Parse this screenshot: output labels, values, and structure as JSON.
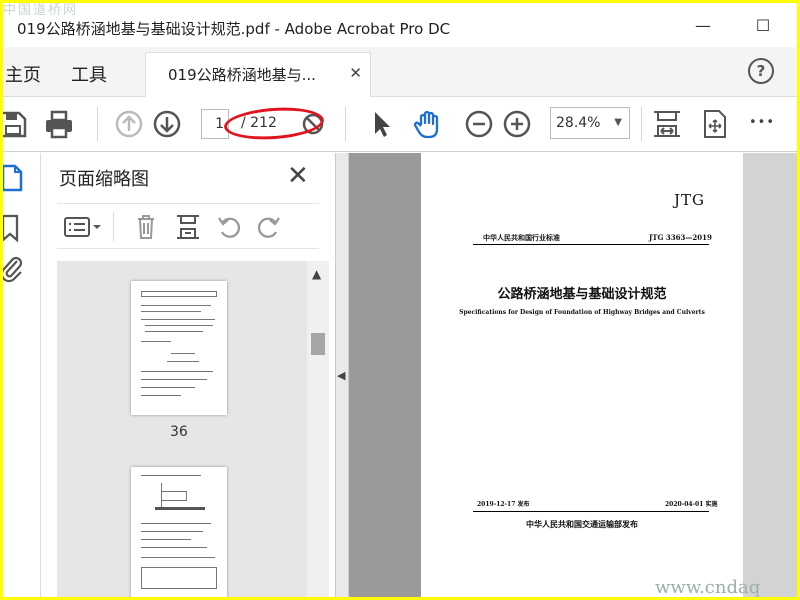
{
  "window": {
    "title": "019公路桥涵地基与基础设计规范.pdf - Adobe Acrobat Pro DC",
    "watermark_top": "中国道桥网",
    "watermark_bottom": "www.cndaq",
    "minimize_glyph": "—",
    "maximize_glyph": "☐"
  },
  "tabs": {
    "home": "主页",
    "tools": "工具",
    "document": "019公路桥涵地基与...",
    "close_glyph": "✕",
    "help_glyph": "?"
  },
  "toolbar": {
    "current_page": "1",
    "total_pages": "/ 212",
    "zoom": "28.4%",
    "zoom_caret": "▼",
    "more_glyph": "•••"
  },
  "thumbnails_panel": {
    "title": "页面缩略图",
    "close_glyph": "✕",
    "pages": [
      {
        "label": "36"
      },
      {
        "label": ""
      }
    ]
  },
  "document_page": {
    "code": "JTG",
    "issuer": "中华人民共和国行业标准",
    "standard_no": "JTG 3363—2019",
    "title_cn": "公路桥涵地基与基础设计规范",
    "title_en": "Specifications for Design of Foundation of Highway Bridges and Culverts",
    "issue_date": "2019-12-17 发布",
    "effective_date": "2020-04-01 实施",
    "publisher": "中华人民共和国交通运输部发布"
  },
  "colors": {
    "border": "#ffff00",
    "annotation_red": "#e0141e",
    "hand_tool_blue": "#1d6fd3"
  }
}
